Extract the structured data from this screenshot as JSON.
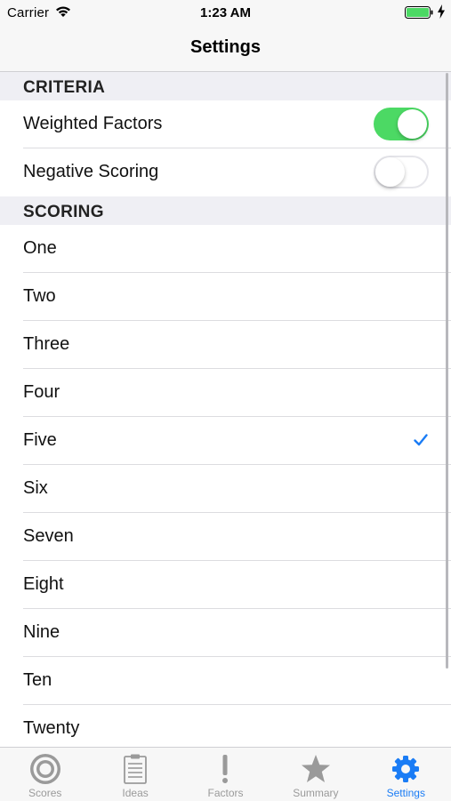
{
  "status_bar": {
    "carrier": "Carrier",
    "time": "1:23 AM",
    "battery_color": "#4cd964"
  },
  "nav": {
    "title": "Settings"
  },
  "sections": {
    "criteria": {
      "header": "CRITERIA",
      "rows": [
        {
          "label": "Weighted Factors",
          "toggle": "on"
        },
        {
          "label": "Negative Scoring",
          "toggle": "off"
        }
      ]
    },
    "scoring": {
      "header": "SCORING",
      "options": [
        "One",
        "Two",
        "Three",
        "Four",
        "Five",
        "Six",
        "Seven",
        "Eight",
        "Nine",
        "Ten",
        "Twenty"
      ],
      "selected": "Five"
    }
  },
  "tabs": [
    {
      "label": "Scores",
      "icon": "target-icon",
      "active": false
    },
    {
      "label": "Ideas",
      "icon": "clipboard-icon",
      "active": false
    },
    {
      "label": "Factors",
      "icon": "exclamation-icon",
      "active": false
    },
    {
      "label": "Summary",
      "icon": "star-icon",
      "active": false
    },
    {
      "label": "Settings",
      "icon": "gear-icon",
      "active": true
    }
  ],
  "colors": {
    "accent": "#1a7cf5",
    "toggle_on": "#4cd964",
    "inactive_tab": "#9a9a9a"
  }
}
